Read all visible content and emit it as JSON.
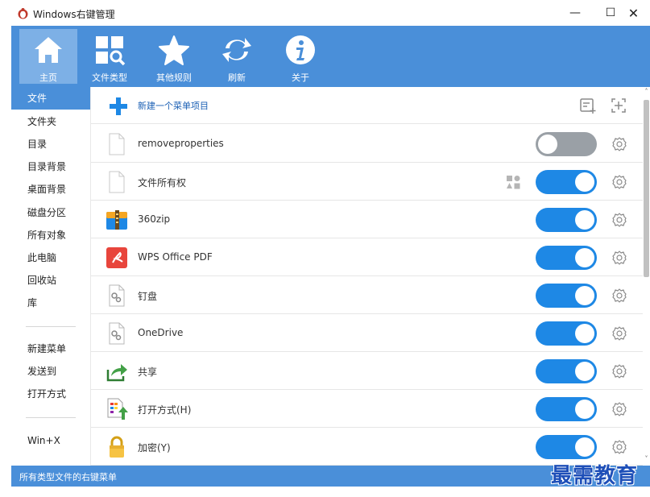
{
  "window": {
    "title": "Windows右键管理",
    "minimize": "—",
    "maximize": "☐",
    "close": "✕"
  },
  "toolbar": {
    "home": "主页",
    "filetypes": "文件类型",
    "otherrules": "其他规则",
    "refresh": "刷新",
    "about": "关于"
  },
  "sidebar": {
    "items": [
      "文件",
      "文件夹",
      "目录",
      "目录背景",
      "桌面背景",
      "磁盘分区",
      "所有对象",
      "此电脑",
      "回收站",
      "库",
      "新建菜单",
      "发送到",
      "打开方式",
      "Win+X"
    ],
    "active_index": 0
  },
  "main": {
    "new_item_label": "新建一个菜单项目",
    "rows": [
      {
        "label": "removeproperties",
        "enabled": false,
        "icon": "blank-file-icon"
      },
      {
        "label": "文件所有权",
        "enabled": true,
        "icon": "blank-file-icon"
      },
      {
        "label": "360zip",
        "enabled": true,
        "icon": "360zip-icon"
      },
      {
        "label": "WPS Office PDF",
        "enabled": true,
        "icon": "wps-pdf-icon"
      },
      {
        "label": "钉盘",
        "enabled": true,
        "icon": "settings-file-icon"
      },
      {
        "label": "OneDrive",
        "enabled": true,
        "icon": "settings-file-icon"
      },
      {
        "label": "共享",
        "enabled": true,
        "icon": "share-icon"
      },
      {
        "label": "打开方式(H)",
        "enabled": true,
        "icon": "open-with-icon"
      },
      {
        "label": "加密(Y)",
        "enabled": true,
        "icon": "lock-icon"
      }
    ]
  },
  "statusbar": {
    "text": "所有类型文件的右键菜单"
  },
  "watermark": "最需教育",
  "colors": {
    "accent": "#4a8fd9",
    "toggle_on": "#1e88e5",
    "toggle_off": "#9aa0a6"
  }
}
